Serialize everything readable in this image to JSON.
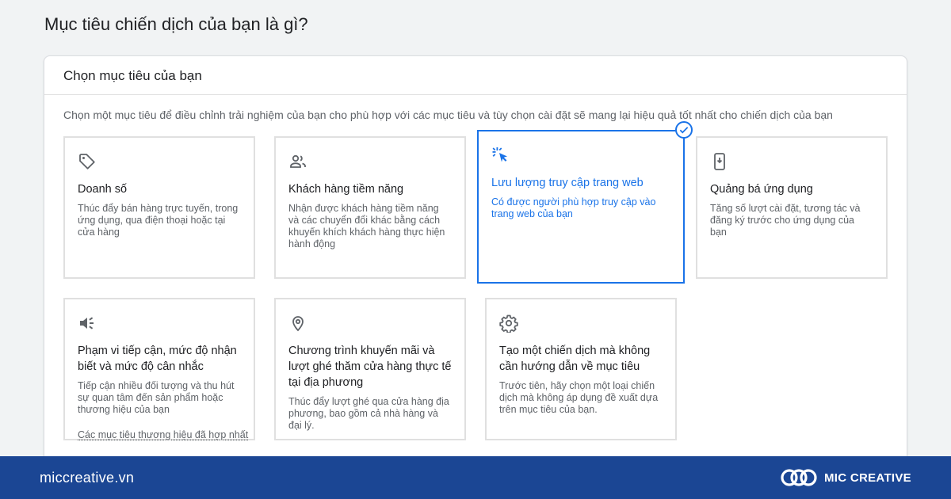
{
  "page": {
    "title": "Mục tiêu chiến dịch của bạn là gì?"
  },
  "panel": {
    "header": "Chọn mục tiêu của bạn",
    "description": "Chọn một mục tiêu để điều chỉnh trải nghiệm của bạn cho phù hợp với các mục tiêu và tùy chọn cài đặt sẽ mang lại hiệu quả tốt nhất cho chiến dịch của bạn"
  },
  "goals": [
    {
      "icon": "tag-icon",
      "title": "Doanh số",
      "description": "Thúc đẩy bán hàng trực tuyến, trong ứng dụng, qua điện thoại hoặc tại cửa hàng",
      "selected": false
    },
    {
      "icon": "people-icon",
      "title": "Khách hàng tiềm năng",
      "description": "Nhận được khách hàng tiềm năng và các chuyển đổi khác bằng cách khuyến khích khách hàng thực hiện hành động",
      "selected": false
    },
    {
      "icon": "cursor-click-icon",
      "title": "Lưu lượng truy cập trang web",
      "description": "Có được người phù hợp truy cập vào trang web của bạn",
      "selected": true
    },
    {
      "icon": "smartphone-icon",
      "title": "Quảng bá ứng dụng",
      "description": "Tăng số lượt cài đặt, tương tác và đăng ký trước cho ứng dụng của bạn",
      "selected": false
    },
    {
      "icon": "speaker-icon",
      "title": "Phạm vi tiếp cận, mức độ nhận biết và mức độ cân nhắc",
      "description": "Tiếp cận nhiều đối tượng và thu hút sự quan tâm đến sản phẩm hoặc thương hiệu của bạn",
      "link": "Các mục tiêu thương hiệu đã hợp nhất",
      "selected": false
    },
    {
      "icon": "location-pin-icon",
      "title": "Chương trình khuyến mãi và lượt ghé thăm cửa hàng thực tế tại địa phương",
      "description": "Thúc đẩy lượt ghé qua cửa hàng địa phương, bao gồm cả nhà hàng và đại lý.",
      "selected": false
    },
    {
      "icon": "gear-icon",
      "title": "Tạo một chiến dịch mà không cần hướng dẫn về mục tiêu",
      "description": "Trước tiên, hãy chọn một loại chiến dịch mà không áp dụng đề xuất dựa trên mục tiêu của bạn.",
      "selected": false
    }
  ],
  "footer": {
    "website": "miccreative.vn",
    "brand": "MIC CREATIVE"
  },
  "colors": {
    "accent": "#1a73e8",
    "footer_bg": "#1b4694",
    "page_bg": "#f1f3f4",
    "muted_text": "#5f6368"
  }
}
